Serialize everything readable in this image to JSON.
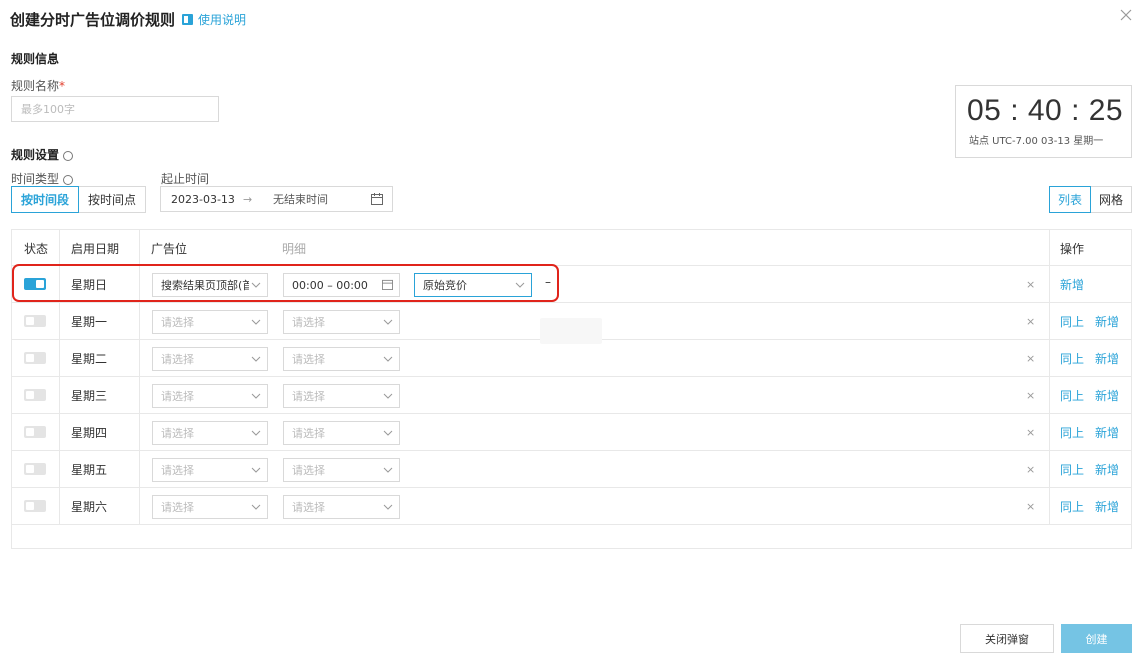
{
  "dialog": {
    "title": "创建分时广告位调价规则",
    "help_label": "使用说明"
  },
  "rule_info": {
    "section_title": "规则信息",
    "name_label": "规则名称",
    "required_mark": "*",
    "name_placeholder": "最多100字"
  },
  "clock": {
    "time": "05 : 40 : 25",
    "subtitle": "站点 UTC-7.00  03-13 星期一"
  },
  "rule_settings": {
    "section_title": "规则设置",
    "time_type_label": "时间类型",
    "time_type_options": [
      "按时间段",
      "按时间点"
    ],
    "time_type_selected": "按时间段",
    "range_label": "起止时间",
    "start_date": "2023-03-13",
    "range_arrow": "→",
    "end_date_placeholder": "无结束时间"
  },
  "view_toggle": {
    "options": [
      "列表",
      "网格"
    ],
    "selected": "列表"
  },
  "table": {
    "headers": {
      "status": "状态",
      "date": "启用日期",
      "placement": "广告位",
      "detail": "明细",
      "actions": "操作"
    },
    "rows": [
      {
        "enabled": true,
        "day": "星期日",
        "placement": "搜索结果页顶部(首",
        "time_range": "00:00 – 00:00",
        "price": "原始竞价",
        "remove": "–",
        "x": "×",
        "actions": [
          "新增"
        ]
      },
      {
        "enabled": false,
        "day": "星期一",
        "placement": "请选择",
        "detail": "请选择",
        "x": "×",
        "actions": [
          "同上",
          "新增"
        ]
      },
      {
        "enabled": false,
        "day": "星期二",
        "placement": "请选择",
        "detail": "请选择",
        "x": "×",
        "actions": [
          "同上",
          "新增"
        ]
      },
      {
        "enabled": false,
        "day": "星期三",
        "placement": "请选择",
        "detail": "请选择",
        "x": "×",
        "actions": [
          "同上",
          "新增"
        ]
      },
      {
        "enabled": false,
        "day": "星期四",
        "placement": "请选择",
        "detail": "请选择",
        "x": "×",
        "actions": [
          "同上",
          "新增"
        ]
      },
      {
        "enabled": false,
        "day": "星期五",
        "placement": "请选择",
        "detail": "请选择",
        "x": "×",
        "actions": [
          "同上",
          "新增"
        ]
      },
      {
        "enabled": false,
        "day": "星期六",
        "placement": "请选择",
        "detail": "请选择",
        "x": "×",
        "actions": [
          "同上",
          "新增"
        ]
      }
    ]
  },
  "footer": {
    "close_label": "关闭弹窗",
    "create_label": "创建"
  },
  "colors": {
    "accent": "#2aa3d8",
    "highlight": "#e0241b",
    "create_button": "#75c4e4"
  }
}
